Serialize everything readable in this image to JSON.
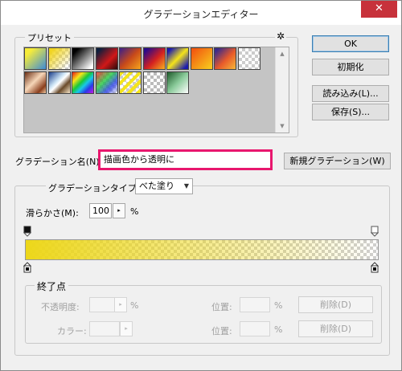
{
  "dialog": {
    "title": "グラデーションエディター",
    "close_glyph": "✕"
  },
  "presets": {
    "label": "プリセット",
    "gear_glyph": "✲",
    "scroll_up": "▲",
    "scroll_down": "▼",
    "swatches": [
      {
        "name": "yellow-blue",
        "css": "linear-gradient(135deg,#f6ec3a 20%,#3c8bd8 100%)"
      },
      {
        "name": "yellow-transparent",
        "css": "linear-gradient(135deg,#f2d51d 10%,rgba(242,213,29,0) 90%),repeating-conic-gradient(#ccc 0 25%,#fff 0 50%) 0 0/8px 8px"
      },
      {
        "name": "black-white",
        "css": "linear-gradient(135deg,#000 15%,#fff 90%)"
      },
      {
        "name": "red-dark",
        "css": "linear-gradient(135deg,#0b1e3d 10%,#d01818 60%,#2a0a0a 100%)"
      },
      {
        "name": "copper-blue",
        "css": "linear-gradient(135deg,#3a1f8a 0%,#c84a1a 50%,#f6a61c 100%)"
      },
      {
        "name": "violet-orange",
        "css": "linear-gradient(135deg,#2a0a8a 10%,#d42020 55%,#f8b020 100%)"
      },
      {
        "name": "blue-yellow-blue",
        "css": "linear-gradient(135deg,#1a1ab0 10%,#f4e41a 50%,#1a1ab0 90%)"
      },
      {
        "name": "orange-yellow",
        "css": "linear-gradient(135deg,#f35a10 10%,#f7c41c 90%)"
      },
      {
        "name": "violet-green-orange",
        "css": "linear-gradient(135deg,#3a2a8a 10%,#e85a2a 55%,#f6b83a 100%)"
      },
      {
        "name": "transparent-stripes",
        "css": "repeating-conic-gradient(#ccc 0 25%,#fff 0 50%) 0 0/8px 8px"
      },
      {
        "name": "copper",
        "css": "linear-gradient(135deg,#6a2e14 0%,#f6d6b8 45%,#8a3e1c 80%,#f0c8a0 100%)"
      },
      {
        "name": "chrome",
        "css": "linear-gradient(135deg,#1a3e8a 0%,#cfe6f6 40%,#fff 50%,#6a4a2a 70%,#f6e6c8 100%)"
      },
      {
        "name": "spectrum",
        "css": "linear-gradient(135deg,#e81818 0%,#f6e418 25%,#18c83a 45%,#18c8e8 60%,#2a3ae8 78%,#c818e8 100%)"
      },
      {
        "name": "transparent-rainbow",
        "css": "linear-gradient(135deg,rgba(240,30,30,.8) 0%,rgba(30,200,60,.8) 40%,rgba(40,60,230,.8) 70%,rgba(255,255,255,0) 100%),repeating-conic-gradient(#ccc 0 25%,#fff 0 50%) 0 0/8px 8px"
      },
      {
        "name": "transparent-yellow-stripes",
        "css": "repeating-linear-gradient(135deg,#f4e41a 0 4px,rgba(255,255,255,0) 4px 8px),repeating-conic-gradient(#ccc 0 25%,#fff 0 50%) 0 0/8px 8px"
      },
      {
        "name": "transparent-checker",
        "css": "repeating-conic-gradient(#bbb 0 25%,#fff 0 50%) 0 0/8px 8px"
      },
      {
        "name": "green-transparent",
        "css": "linear-gradient(135deg,#1e5a2a 0%,#8acb9a 50%,#fff 100%)"
      }
    ]
  },
  "buttons": {
    "ok": "OK",
    "reset": "初期化",
    "load": "読み込み(L)...",
    "save": "保存(S)...",
    "new_gradient": "新規グラデーション(W)"
  },
  "name_field": {
    "label": "グラデーション名(N):",
    "value": "描画色から透明に"
  },
  "gradient_type": {
    "label": "グラデーションタイプ(T):",
    "value": "べた塗り",
    "arrow": "▼"
  },
  "smoothness": {
    "label": "滑らかさ(M):",
    "value": "100",
    "unit": "%",
    "stepper": "▸"
  },
  "stops": {
    "label": "終了点",
    "opacity_label": "不透明度:",
    "opacity_unit": "%",
    "color_label": "カラー:",
    "location_label_1": "位置:",
    "location_unit_1": "%",
    "location_label_2": "位置:",
    "location_unit_2": "%",
    "delete_1": "削除(D)",
    "delete_2": "削除(D)",
    "stepper": "▸"
  },
  "colors": {
    "foreground": "#edd71a",
    "highlight_border": "#e8176e"
  }
}
